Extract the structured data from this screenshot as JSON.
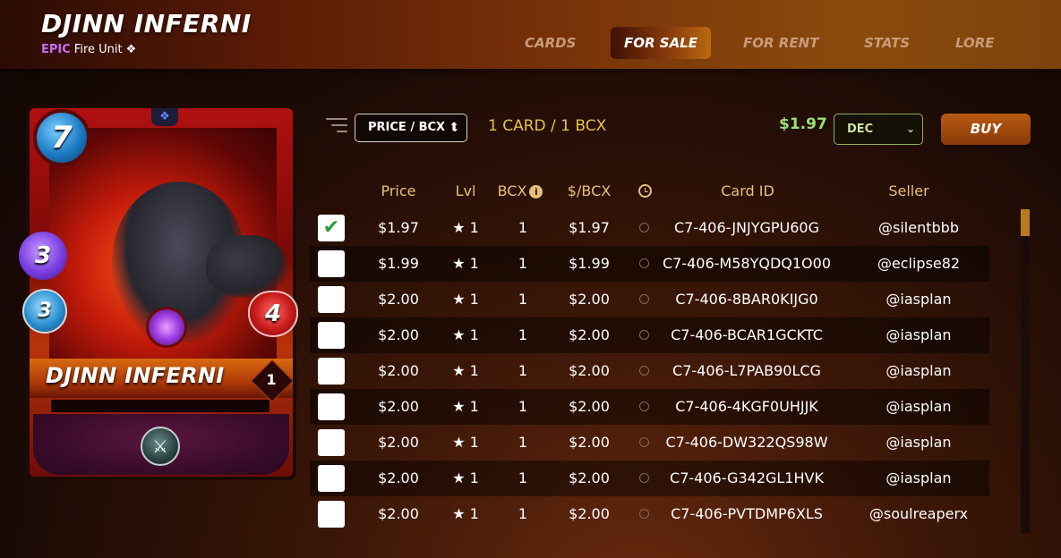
{
  "header": {
    "title": "DJINN INFERNI",
    "rarity": "EPIC",
    "unit_type": "Fire Unit",
    "tabs": [
      "CARDS",
      "FOR SALE",
      "FOR RENT",
      "STATS",
      "LORE"
    ],
    "active_tab": "FOR SALE"
  },
  "card": {
    "name": "DJINN INFERNI",
    "mana": "7",
    "magic": "3",
    "armor": "3",
    "health": "4",
    "level": "1",
    "icons": [
      "diamond-edition-icon",
      "magic-gem-icon",
      "ability-axe-icon"
    ]
  },
  "toolbar": {
    "sort_value": "PRICE / BCX ⬆",
    "count_text": "1 CARD / 1 BCX",
    "total_price": "$1.97",
    "currency_value": "DEC",
    "buy_label": "BUY"
  },
  "table": {
    "headers": {
      "price": "Price",
      "lvl": "Lvl",
      "bcx": "BCX",
      "per_bcx": "$/BCX",
      "card_id": "Card ID",
      "seller": "Seller"
    },
    "rows": [
      {
        "checked": "✔",
        "price": "$1.97",
        "lvl": "★ 1",
        "bcx": "1",
        "per_bcx": "$1.97",
        "card_id": "C7-406-JNJYGPU60G",
        "seller": "@silentbbb"
      },
      {
        "checked": "",
        "price": "$1.99",
        "lvl": "★ 1",
        "bcx": "1",
        "per_bcx": "$1.99",
        "card_id": "C7-406-M58YQDQ1O00",
        "seller": "@eclipse82"
      },
      {
        "checked": "",
        "price": "$2.00",
        "lvl": "★ 1",
        "bcx": "1",
        "per_bcx": "$2.00",
        "card_id": "C7-406-8BAR0KIJG0",
        "seller": "@iasplan"
      },
      {
        "checked": "",
        "price": "$2.00",
        "lvl": "★ 1",
        "bcx": "1",
        "per_bcx": "$2.00",
        "card_id": "C7-406-BCAR1GCKTC",
        "seller": "@iasplan"
      },
      {
        "checked": "",
        "price": "$2.00",
        "lvl": "★ 1",
        "bcx": "1",
        "per_bcx": "$2.00",
        "card_id": "C7-406-L7PAB90LCG",
        "seller": "@iasplan"
      },
      {
        "checked": "",
        "price": "$2.00",
        "lvl": "★ 1",
        "bcx": "1",
        "per_bcx": "$2.00",
        "card_id": "C7-406-4KGF0UHJJK",
        "seller": "@iasplan"
      },
      {
        "checked": "",
        "price": "$2.00",
        "lvl": "★ 1",
        "bcx": "1",
        "per_bcx": "$2.00",
        "card_id": "C7-406-DW322QS98W",
        "seller": "@iasplan"
      },
      {
        "checked": "",
        "price": "$2.00",
        "lvl": "★ 1",
        "bcx": "1",
        "per_bcx": "$2.00",
        "card_id": "C7-406-G342GL1HVK",
        "seller": "@iasplan"
      },
      {
        "checked": "",
        "price": "$2.00",
        "lvl": "★ 1",
        "bcx": "1",
        "per_bcx": "$2.00",
        "card_id": "C7-406-PVTDMP6XLS",
        "seller": "@soulreaperx"
      }
    ]
  }
}
